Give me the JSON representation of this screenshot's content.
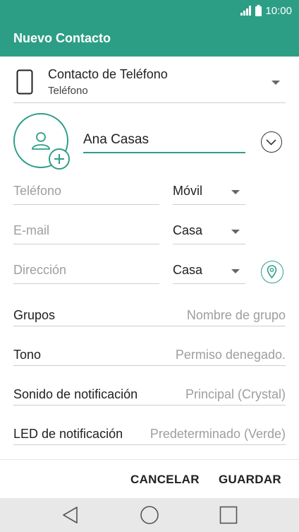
{
  "status_bar": {
    "time": "10:00",
    "icons": [
      "signal-icon",
      "battery-icon"
    ]
  },
  "app_bar": {
    "title": "Nuevo Contacto"
  },
  "account": {
    "name": "Contacto de Teléfono",
    "type": "Teléfono"
  },
  "contact": {
    "name_value": "Ana Casas"
  },
  "phone": {
    "placeholder": "Teléfono",
    "label_type": "Móvil"
  },
  "email": {
    "placeholder": "E-mail",
    "label_type": "Casa"
  },
  "address": {
    "placeholder": "Dirección",
    "label_type": "Casa"
  },
  "rows": {
    "groups": {
      "label": "Grupos",
      "value": "Nombre de grupo"
    },
    "ringtone": {
      "label": "Tono",
      "value": "Permiso denegado."
    },
    "notification_sound": {
      "label": "Sonido de notificación",
      "value": "Principal (Crystal)"
    },
    "notification_led": {
      "label": "LED de notificación",
      "value": "Predeterminado (Verde)"
    }
  },
  "actions": {
    "cancel": "CANCELAR",
    "save": "GUARDAR"
  },
  "colors": {
    "accent": "#2d9e86",
    "navbar": "#e8e8e8"
  }
}
